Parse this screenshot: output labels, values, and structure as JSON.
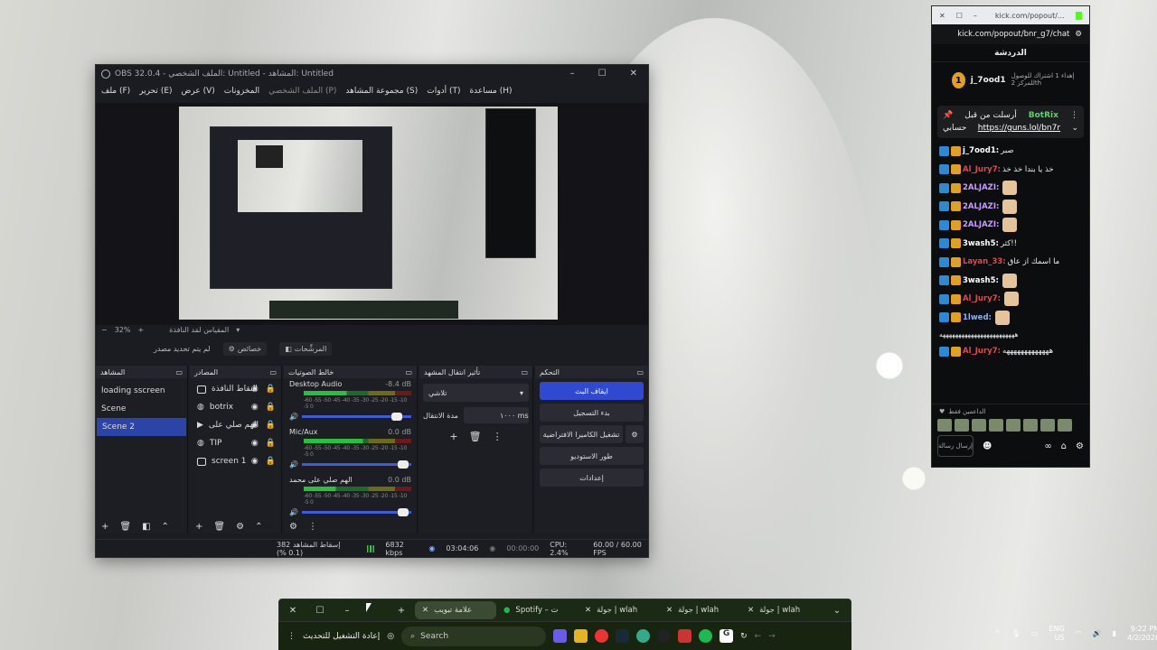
{
  "obs": {
    "title": "OBS 32.0.4 - الملف الشخصي: Untitled - المشاهد: Untitled",
    "menu": [
      "ملف (F)",
      "تحرير (E)",
      "عرض (V)",
      "المخزونات",
      "الملف الشخصي (P)",
      "مجموعة المشاهد (S)",
      "أدوات (T)",
      "مساعدة (H)"
    ],
    "zoom": "32%",
    "zoom_label": "المقياس لمَد النافذة",
    "no_source": "لم يتم تحديد مصدر",
    "properties_btn": "خصائص",
    "filters_btn": "المرشِّحات",
    "docks": {
      "scenes": "المشاهد",
      "sources": "المصادر",
      "mixer": "خالط الصوتيات",
      "transitions": "تأثير انتقال المشهد",
      "controls": "التحكم"
    },
    "scenes": [
      "loading sscreen",
      "Scene",
      "Scene 2"
    ],
    "sources": [
      "النقاط النافذة",
      "botrix",
      "الهم صلي على",
      "TIP",
      "screen 1"
    ],
    "mixer": [
      {
        "name": "Desktop Audio",
        "db": "-8.4 dB",
        "level": "40%",
        "vol": 0.82
      },
      {
        "name": "Mic/Aux",
        "db": "0.0 dB",
        "level": "55%",
        "vol": 0.95
      },
      {
        "name": "الهم صلي على محمد",
        "db": "0.0 dB",
        "level": "30%",
        "vol": 0.95
      }
    ],
    "meter_scale": "-60 -55 -50 -45 -40 -35 -30 -25 -20 -15 -10 -5 0",
    "transition": "تلاشي",
    "duration_label": "مدة الانتقال",
    "duration": "١٠٠٠ ms",
    "controls": [
      "ايقاف البث",
      "بدء التسجيل",
      "تشغيل الكاميرا الافتراضية",
      "طور الاستوديو",
      "إعدادات"
    ],
    "status": {
      "dropped": "إسقاط المشاهد 382 (0.1 %)",
      "kbps": "6832 kbps",
      "stream_time": "03:04:06",
      "rec_time": "00:00:00",
      "cpu": "CPU: 2.4%",
      "fps": "60.00 / 60.00 FPS"
    }
  },
  "chat": {
    "url": "kick.com/popout/...",
    "url2": "kick.com/popout/bnr_g7/chat",
    "title": "الدردشة",
    "goal_user": "j_7ood1",
    "goal_num": "1",
    "goal_text": "إهداء 1 اشتراك للوصول للمركز 2th",
    "pinned_by": "أرسلت من قبل",
    "pinned_user": "BotRix",
    "pinned_text": "حسابي",
    "pinned_link": "https://guns.lol/bn7r",
    "messages": [
      {
        "user": "j_7ood1:",
        "text": "صبر",
        "color": "#fff"
      },
      {
        "user": "Al_Jury7:",
        "text": "خذ يا بندا خذ خذ",
        "color": "#e0474f"
      },
      {
        "user": "2ALJAZI:",
        "text": "",
        "color": "#c89cff"
      },
      {
        "user": "2ALJAZI:",
        "text": "",
        "color": "#c89cff"
      },
      {
        "user": "2ALJAZI:",
        "text": "",
        "color": "#c89cff"
      },
      {
        "user": "3wash5:",
        "text": "كثر!!",
        "color": "#fff"
      },
      {
        "user": "Layan_33:",
        "text": "ما اسمك از عاق",
        "color": "#e0474f"
      },
      {
        "user": "3wash5:",
        "text": "",
        "color": "#fff"
      },
      {
        "user": "Al_Jury7:",
        "text": "",
        "color": "#e0474f"
      },
      {
        "user": "1lwed:",
        "text": "",
        "color": "#7fb4ff"
      }
    ],
    "long_msg": "ههههههههههههههههههههههههه",
    "last_user": "Al_Jury7:",
    "last_text": "هههههههههههههه",
    "supporters": "الداعمين فقط",
    "input_hint": "إرسال رسالة"
  },
  "tabs": [
    {
      "label": "علامة تبويب",
      "active": true
    },
    {
      "label": "Spotify – ت",
      "active": false
    },
    {
      "label": "جولة | wlah",
      "active": false
    },
    {
      "label": "جولة | wlah",
      "active": false
    },
    {
      "label": "جولة | wlah",
      "active": false
    }
  ],
  "taskbar": {
    "restart": "إعادة التشغيل للتحديث",
    "search": "Search"
  },
  "tray": {
    "lang": "ENG",
    "region": "US",
    "time": "9:22 PM",
    "date": "4/2/2026"
  }
}
